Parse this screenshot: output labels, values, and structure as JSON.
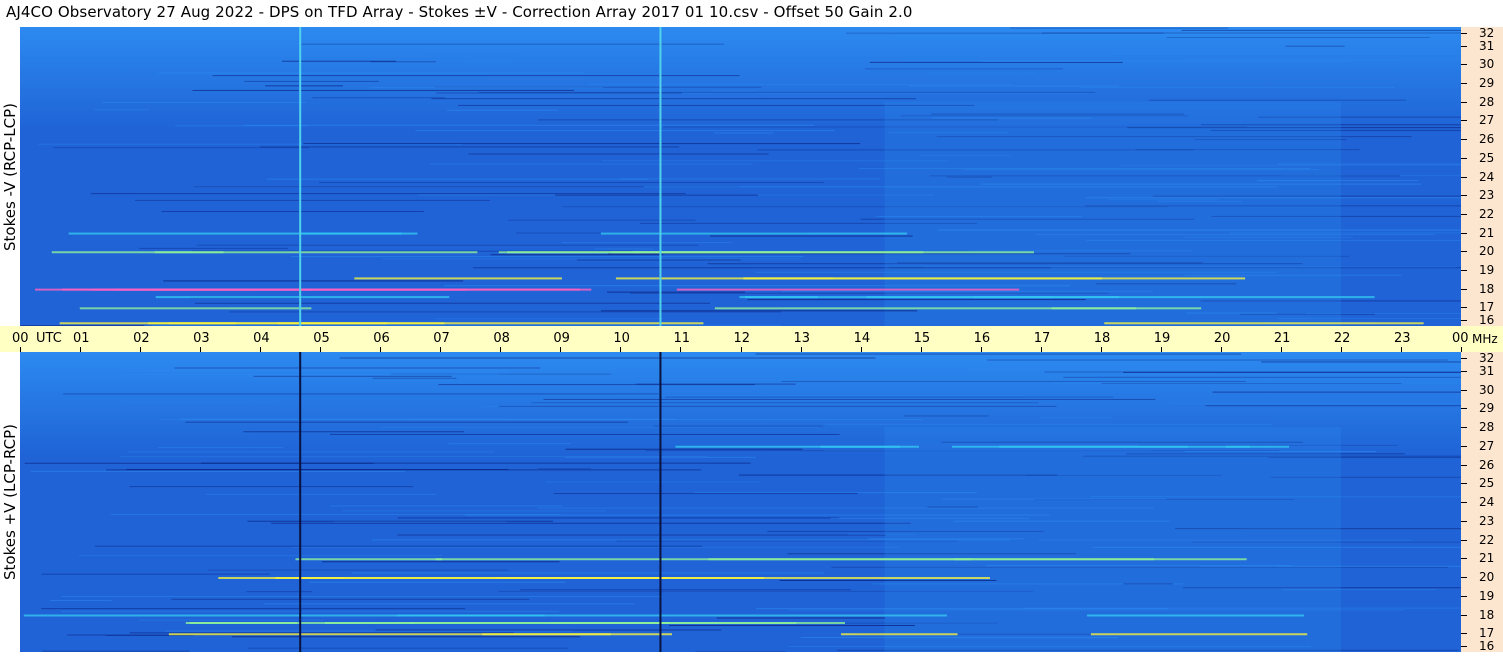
{
  "title": "AJ4CO Observatory  27 Aug 2022  -  DPS on TFD Array  -  Stokes ±V  -  Correction Array 2017 01 10.csv  -  Offset 50  Gain 2.0",
  "chart_data": [
    {
      "type": "heatmap",
      "panel": "top",
      "ylabel": "Stokes -V (RCP-LCP)",
      "x_unit": "UTC",
      "y_unit": "MHz",
      "x_ticks": [
        "00",
        "01",
        "02",
        "03",
        "04",
        "05",
        "06",
        "07",
        "08",
        "09",
        "10",
        "11",
        "12",
        "13",
        "14",
        "15",
        "16",
        "17",
        "18",
        "19",
        "20",
        "21",
        "22",
        "23",
        "00"
      ],
      "y_ticks": [
        "32",
        "31",
        "30",
        "29",
        "28",
        "27",
        "26",
        "25",
        "24",
        "23",
        "22",
        "21",
        "20",
        "19",
        "18",
        "17",
        "16"
      ],
      "xlim_hours": [
        0,
        24
      ],
      "ylim_mhz": [
        16,
        32
      ],
      "vertical_lines_utc_hours": [
        4.65,
        10.65
      ],
      "vertical_line_color": "#4fd2ea",
      "interference_bands_mhz": [
        21,
        20,
        18.6,
        18,
        17.6,
        17,
        16.2
      ],
      "colormap": [
        "#0a1c7a",
        "#1f63d6",
        "#2c8af0",
        "#33c6f0",
        "#8ef09a",
        "#f4f040",
        "#ff60c0"
      ]
    },
    {
      "type": "heatmap",
      "panel": "bottom",
      "ylabel": "Stokes +V (LCP-RCP)",
      "x_unit": "UTC",
      "y_unit": "MHz",
      "y_ticks": [
        "32",
        "31",
        "30",
        "29",
        "28",
        "27",
        "26",
        "25",
        "24",
        "23",
        "22",
        "21",
        "20",
        "19",
        "18",
        "17",
        "16"
      ],
      "xlim_hours": [
        0,
        24
      ],
      "ylim_mhz": [
        16,
        32
      ],
      "vertical_lines_utc_hours": [
        4.65,
        10.65
      ],
      "vertical_line_color": "#0a1240",
      "interference_bands_mhz": [
        27,
        21,
        20,
        18,
        17.6,
        17
      ],
      "colormap": [
        "#0a1c7a",
        "#1f63d6",
        "#2c8af0",
        "#33c6f0",
        "#8ef09a",
        "#f4f040"
      ]
    }
  ],
  "axis": {
    "utc_label": "UTC",
    "mhz_label": "MHz"
  },
  "colors": {
    "time_axis_bg": "#ffffc4",
    "freq_axis_bg": "#fde6cf",
    "base_blue": "#1f63d6"
  }
}
